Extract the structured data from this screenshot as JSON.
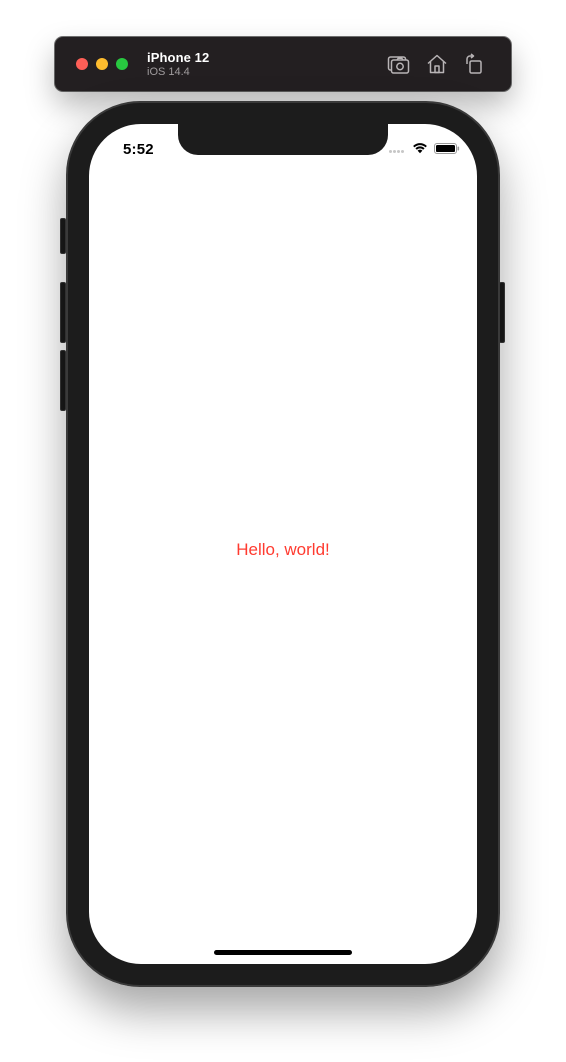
{
  "simulator": {
    "device_name": "iPhone 12",
    "os_version": "iOS 14.4",
    "toolbar_buttons": [
      {
        "icon": "screenshot-icon"
      },
      {
        "icon": "home-icon"
      },
      {
        "icon": "rotate-icon"
      }
    ],
    "window_controls": [
      "close",
      "minimize",
      "zoom"
    ]
  },
  "status_bar": {
    "time": "5:52",
    "wifi": "wifi-icon",
    "battery": "battery-icon"
  },
  "app": {
    "message": "Hello, world!",
    "message_color": "#ff3b30"
  },
  "colors": {
    "toolbar_bg": "#231f21",
    "device_frame": "#1c1c1c",
    "screen_bg": "#ffffff"
  }
}
